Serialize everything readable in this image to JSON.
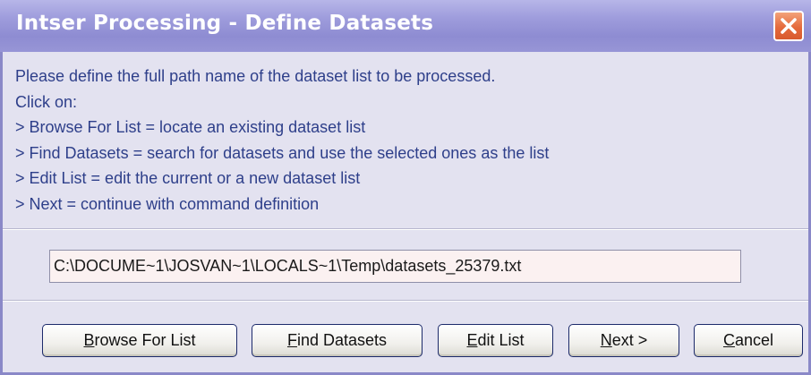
{
  "window": {
    "title": "Intser Processing - Define Datasets",
    "close_icon": "close-icon"
  },
  "instructions": [
    "Please define the full path name of the dataset list to be processed.",
    "Click on:",
    "> Browse For List = locate an existing dataset list",
    "> Find Datasets = search for datasets and use the selected ones as the list",
    "> Edit List = edit the current or a new dataset list",
    "> Next = continue with command definition"
  ],
  "path_field": {
    "value": "C:\\DOCUME~1\\JOSVAN~1\\LOCALS~1\\Temp\\datasets_25379.txt"
  },
  "buttons": {
    "browse": {
      "mnemonic": "B",
      "rest": "rowse For List"
    },
    "find": {
      "mnemonic": "F",
      "rest": "ind Datasets"
    },
    "edit": {
      "mnemonic": "E",
      "rest": "dit List"
    },
    "next": {
      "mnemonic": "N",
      "rest": "ext >"
    },
    "cancel": {
      "mnemonic": "C",
      "rest": "ancel"
    }
  },
  "colors": {
    "titlebar": "#9e9cdc",
    "window_bg": "#e3e2f0",
    "instruction_text": "#2e3f8a",
    "close_button": "#e56a3c",
    "input_bg": "#fbf1f1"
  }
}
